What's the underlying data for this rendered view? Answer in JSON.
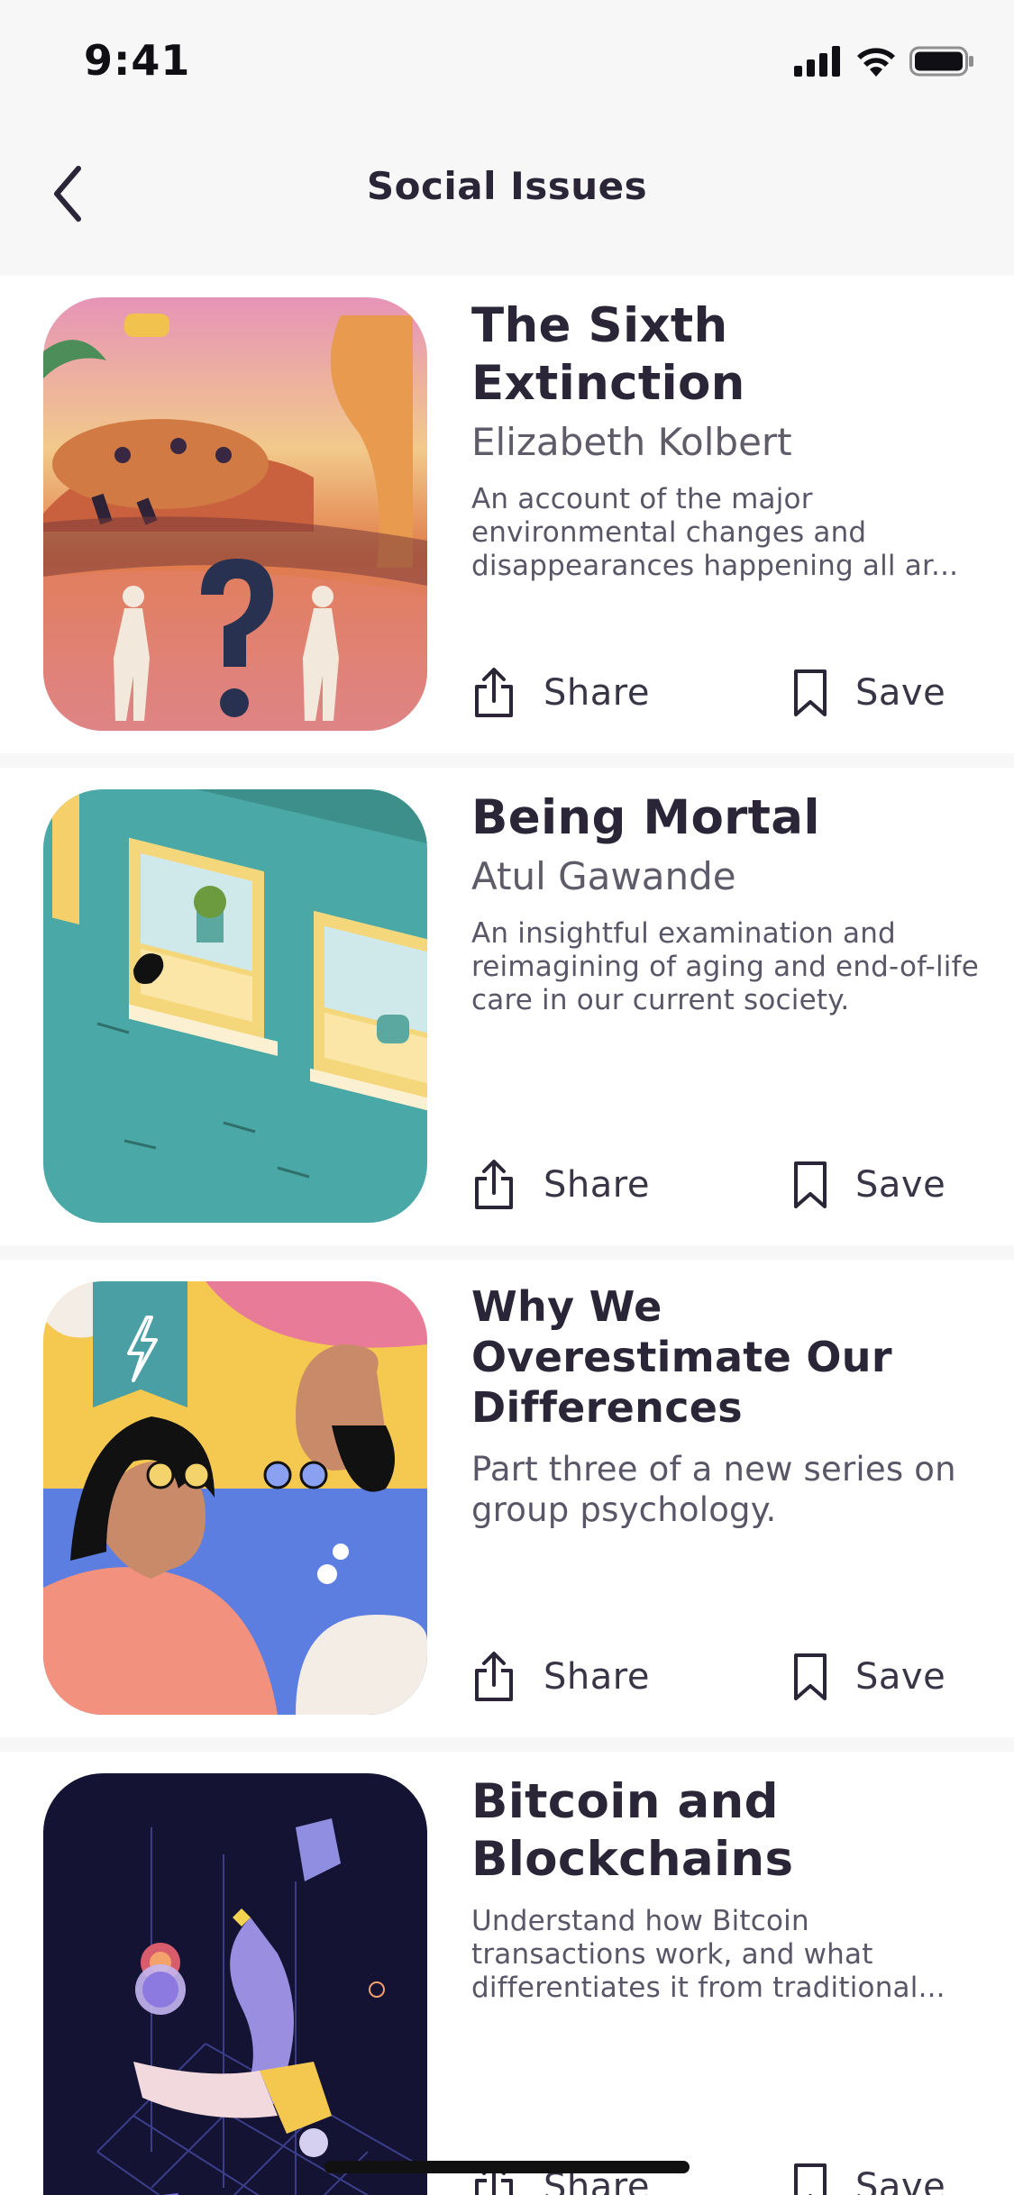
{
  "status_bar": {
    "time": "9:41"
  },
  "nav": {
    "title": "Social Issues"
  },
  "articles": [
    {
      "title": "The Sixth Extinction",
      "author": "Elizabeth Kolbert",
      "description": "An account of the major environmental changes and disappearances happening all ar...",
      "share_label": "Share",
      "save_label": "Save"
    },
    {
      "title": "Being Mortal",
      "author": "Atul Gawande",
      "description": "An insightful examination and reimagining of aging and end-of-life care in our current society.",
      "share_label": "Share",
      "save_label": "Save"
    },
    {
      "title": "Why We Overestimate Our Differences",
      "author": "",
      "description": "Part three of a new series on group psychology.",
      "share_label": "Share",
      "save_label": "Save"
    },
    {
      "title": "Bitcoin and Blockchains",
      "author": "",
      "description": "Understand how Bitcoin transactions work, and what differentiates it from traditional...",
      "share_label": "Share",
      "save_label": "Save"
    }
  ],
  "colors": {
    "background": "#f8f7f7",
    "card": "#ffffff",
    "text_primary": "#2a2537",
    "text_secondary": "#5f5b69"
  }
}
